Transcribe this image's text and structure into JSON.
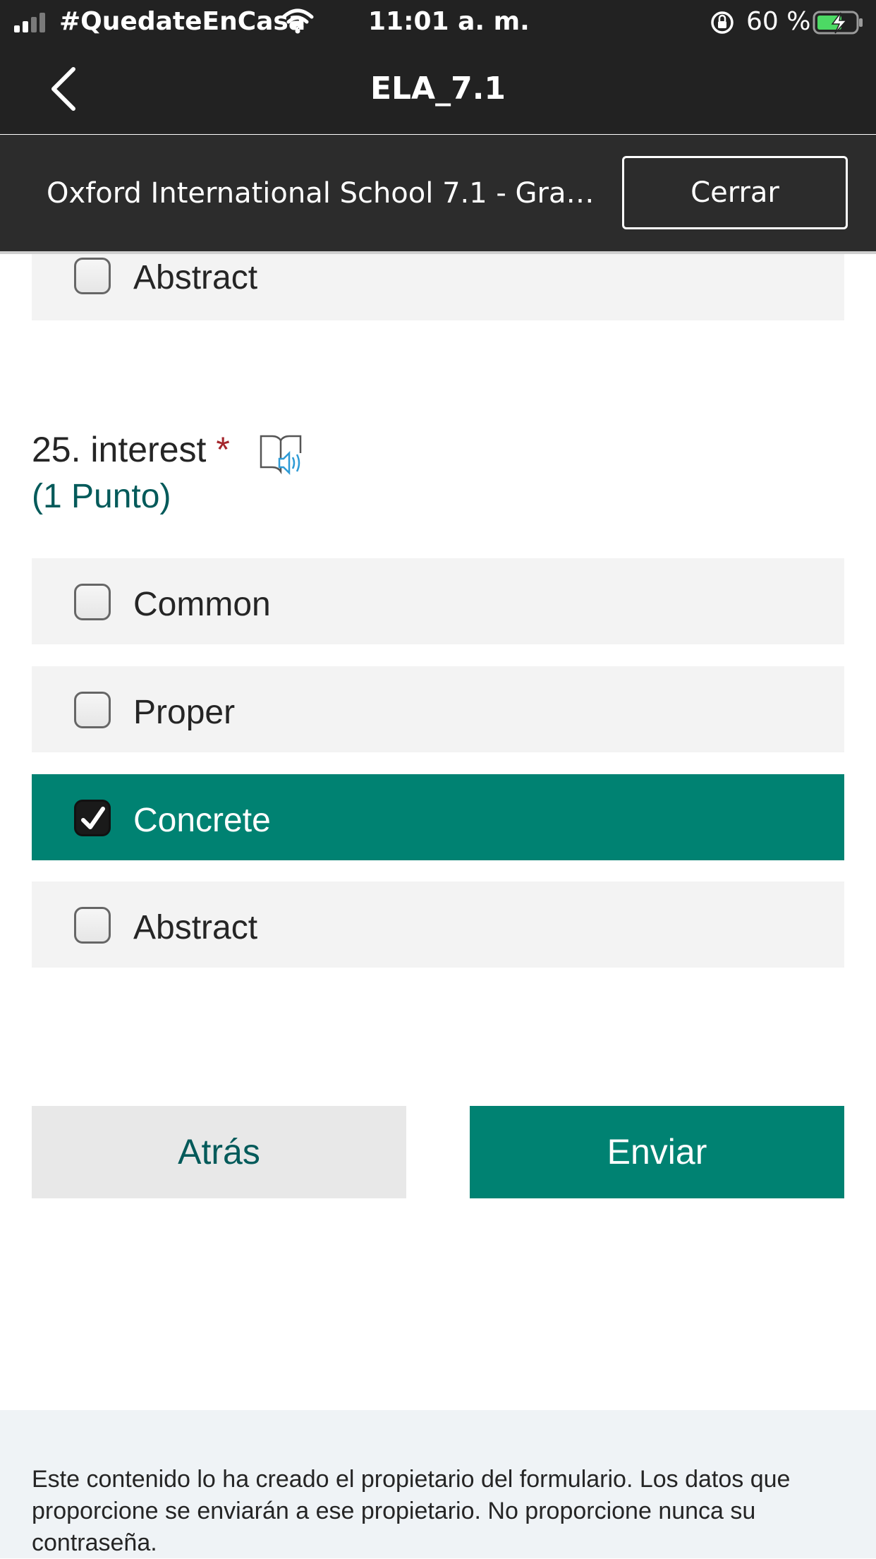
{
  "status_bar": {
    "carrier": "#QuedateEnCasa",
    "time": "11:01 a. m.",
    "battery": "60 %"
  },
  "nav": {
    "title": "ELA_7.1"
  },
  "form_header": {
    "title": "Oxford International School 7.1 - Gramm...",
    "close_label": "Cerrar"
  },
  "previous_question": {
    "options": [
      {
        "label": "Abstract",
        "checked": false
      }
    ]
  },
  "question": {
    "number": "25.",
    "text": "interest",
    "required_mark": "*",
    "points": "(1 Punto)",
    "options": [
      {
        "label": "Common",
        "checked": false
      },
      {
        "label": "Proper",
        "checked": false
      },
      {
        "label": "Concrete",
        "checked": true
      },
      {
        "label": "Abstract",
        "checked": false
      }
    ]
  },
  "buttons": {
    "back": "Atrás",
    "submit": "Enviar"
  },
  "footer": {
    "disclaimer": "Este contenido lo ha creado el propietario del formulario. Los datos que proporcione se enviarán a ese propietario. No proporcione nunca su contraseña."
  },
  "colors": {
    "accent": "#008272",
    "header_bg": "#222222",
    "points_text": "#035a5a",
    "required": "#a4262c"
  }
}
